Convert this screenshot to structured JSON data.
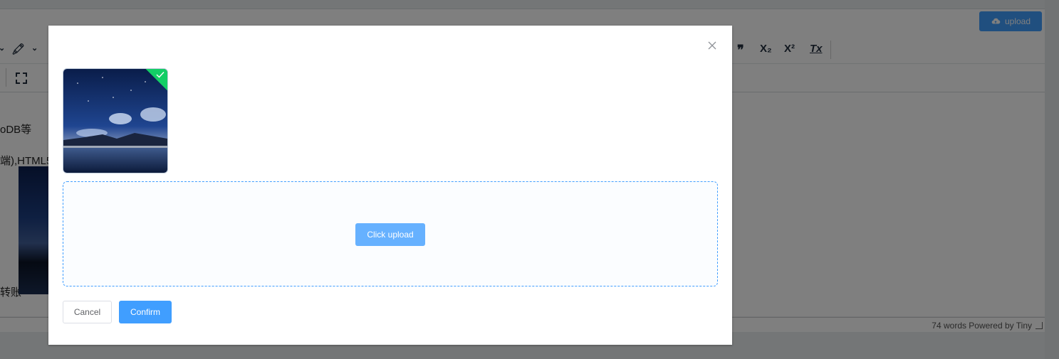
{
  "editor": {
    "upload_button": "upload",
    "toolbar_row1_icons": [
      "chevron-down-icon",
      "highlight-icon",
      "chevron-down-icon",
      "blockquote-icon",
      "subscript-icon",
      "superscript-icon",
      "clear-format-icon"
    ],
    "toolbar_row2_icons": [
      "fullscreen-icon"
    ],
    "subscript_label": "X₂",
    "superscript_label": "X²",
    "blockquote_label": "❞",
    "clear_format_label": "Tx",
    "content_lines": [
      "oDB等",
      "端),HTML5",
      "转账"
    ],
    "status_words": "74 words",
    "status_powered": "Powered by Tiny"
  },
  "dialog": {
    "close_icon": "close-icon",
    "thumbnail": {
      "status": "success",
      "icon": "check-icon",
      "accent": "#13ce66"
    },
    "dropzone": {
      "button_label": "Click upload"
    },
    "cancel_label": "Cancel",
    "confirm_label": "Confirm"
  },
  "colors": {
    "primary": "#409eff",
    "primary_light": "#66b1ff",
    "success": "#13ce66"
  }
}
